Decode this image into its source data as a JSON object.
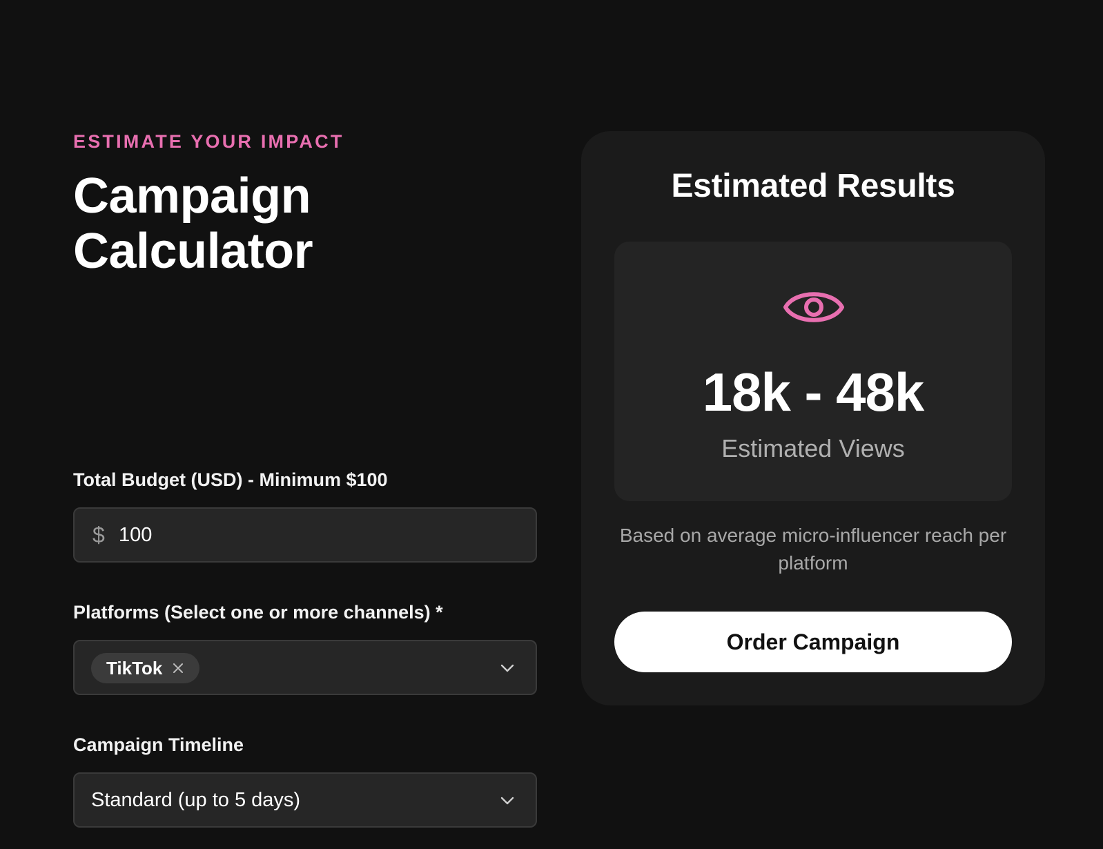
{
  "calculator": {
    "eyebrow": "ESTIMATE YOUR IMPACT",
    "title_line1": "Campaign",
    "title_line2": "Calculator",
    "budget": {
      "label": "Total Budget (USD) - Minimum $100",
      "currency_symbol": "$",
      "value": "100"
    },
    "platforms": {
      "label": "Platforms (Select one or more channels) *",
      "selected": [
        {
          "label": "TikTok"
        }
      ],
      "dropdown_icon": "chevron-down-icon"
    },
    "timeline": {
      "label": "Campaign Timeline",
      "value": "Standard (up to 5 days)",
      "dropdown_icon": "chevron-down-icon"
    }
  },
  "results": {
    "title": "Estimated Results",
    "icon": "eye-icon",
    "views_range": "18k - 48k",
    "views_label": "Estimated Views",
    "note": "Based on average micro-influencer reach per platform",
    "order_button": "Order Campaign"
  },
  "colors": {
    "background": "#111111",
    "accent": "#e86fb0",
    "card": "#1b1b1b",
    "inner_card": "#242424",
    "input": "#262626",
    "button": "#ffffff"
  }
}
